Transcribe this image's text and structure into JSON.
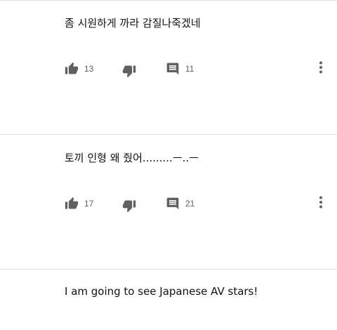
{
  "comments": [
    {
      "text": "좀 시원하게 까라 감질나죽겠네",
      "likes": "13",
      "replies": "11"
    },
    {
      "text": "토끼 인형 왜 줬어.........ㅡ..ㅡ",
      "likes": "17",
      "replies": "21"
    },
    {
      "text": "I am going to see Japanese AV stars!"
    }
  ],
  "icons": {
    "like": "thumbs-up-icon",
    "dislike": "thumbs-down-icon",
    "reply": "comment-bubble-icon",
    "more": "more-vertical-icon"
  },
  "colors": {
    "icon": "#606060",
    "text": "#111111",
    "divider": "#e3e3e3"
  }
}
